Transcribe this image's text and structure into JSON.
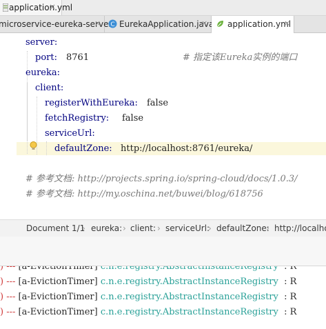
{
  "window": {
    "title_tab": "application.yml"
  },
  "editor_tabs": [
    {
      "label": "microservice-eureka-server",
      "close": "×"
    },
    {
      "label": "EurekaApplication.java",
      "close": "×"
    },
    {
      "label": "application.yml",
      "close": "×"
    }
  ],
  "code": {
    "l1": "server:",
    "l2_key": "port:",
    "l2_val": "8761",
    "l2_comment": "# 指定该Eureka实例的端口",
    "l3": "eureka:",
    "l4": "client:",
    "l5_key": "registerWithEureka:",
    "l5_val": "false",
    "l6_key": "fetchRegistry:",
    "l6_val": "false",
    "l7": "serviceUrl:",
    "l8_key": "defaultZone:",
    "l8_val": "http://localhost:8761/eureka/",
    "l10": "# 参考文档: http://projects.spring.io/spring-cloud/docs/1.0.3/",
    "l11": "# 参考文档: http://my.oschina.net/buwei/blog/618756"
  },
  "breadcrumbs": {
    "items": [
      "Document 1/1",
      "eureka:",
      "client:",
      "serviceUrl:",
      "defaultZone:",
      "http://localhos"
    ],
    "separator": "›"
  },
  "console": {
    "lines": [
      {
        "prefix": ") --- ",
        "thread": "[a-EvictionTimer]",
        "class": "c.n.e.registry.AbstractInstanceRegistry",
        "tail": ": R"
      },
      {
        "prefix": ") --- ",
        "thread": "[a-EvictionTimer]",
        "class": "c.n.e.registry.AbstractInstanceRegistry",
        "tail": ": R"
      },
      {
        "prefix": ") --- ",
        "thread": "[a-EvictionTimer]",
        "class": "c.n.e.registry.AbstractInstanceRegistry",
        "tail": ": R"
      },
      {
        "prefix": ") --- ",
        "thread": "[a-EvictionTimer]",
        "class": "c.n.e.registry.AbstractInstanceRegistry",
        "tail": ": R"
      }
    ]
  },
  "colors": {
    "yaml_key": "#000080",
    "comment": "#7a7a7a",
    "console_class": "#2aa198",
    "caret_line": "#fbf7dc"
  }
}
